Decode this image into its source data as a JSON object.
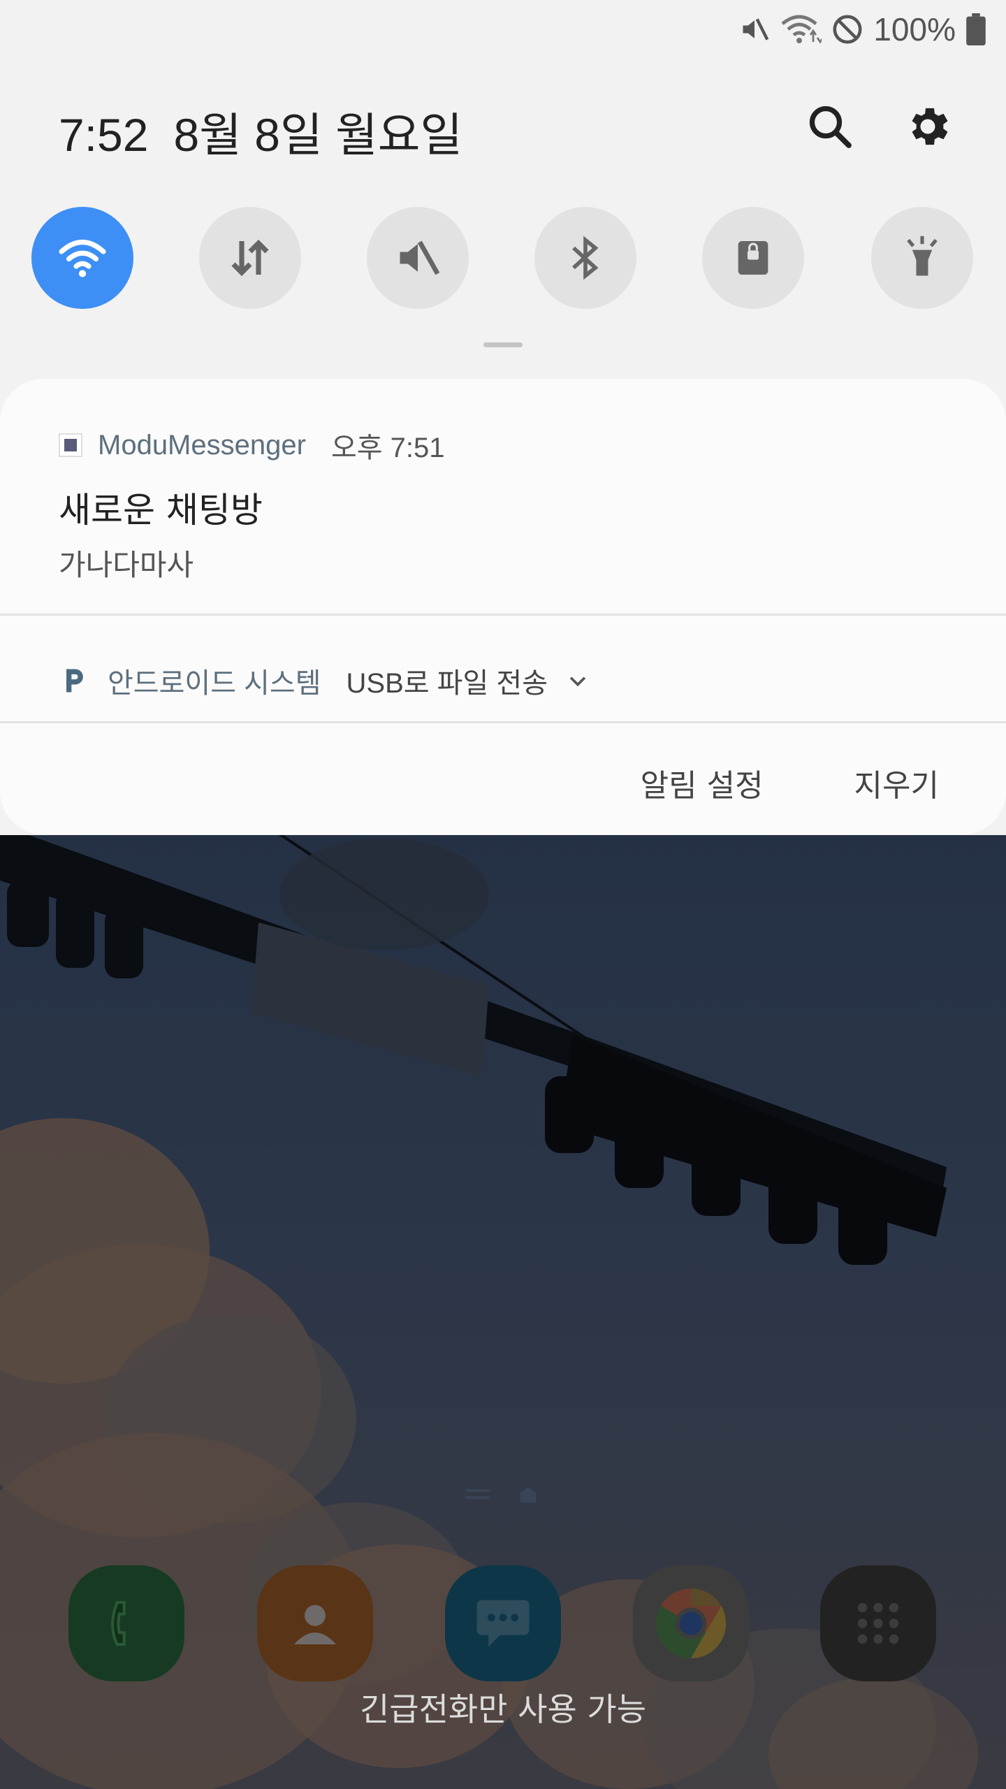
{
  "status_bar": {
    "battery": "100%",
    "icons": [
      "mute-icon",
      "wifi-data-icon",
      "do-not-disturb-icon",
      "battery-icon"
    ]
  },
  "header": {
    "time": "7:52",
    "date": "8월 8일 월요일",
    "search_icon": "search-icon",
    "settings_icon": "gear-icon"
  },
  "quick_settings": [
    {
      "name": "wifi",
      "icon": "wifi-icon",
      "active": true
    },
    {
      "name": "mobile-data",
      "icon": "data-transfer-icon",
      "active": false
    },
    {
      "name": "sound",
      "icon": "mute-icon",
      "active": false
    },
    {
      "name": "bluetooth",
      "icon": "bluetooth-icon",
      "active": false
    },
    {
      "name": "lock",
      "icon": "lock-icon",
      "active": false
    },
    {
      "name": "flashlight",
      "icon": "flashlight-icon",
      "active": false
    }
  ],
  "notification": {
    "app_name": "ModuMessenger",
    "time": "오후 7:51",
    "title": "새로운 채팅방",
    "body": "가나다마사"
  },
  "system_notification": {
    "app_name": "안드로이드 시스템",
    "text": "USB로 파일 전송"
  },
  "actions": {
    "settings_label": "알림 설정",
    "clear_label": "지우기"
  },
  "dock": {
    "apps": [
      "phone-icon",
      "contacts-icon",
      "messages-icon",
      "chrome-icon",
      "apps-icon"
    ]
  },
  "footer": {
    "emergency_text": "긴급전화만 사용 가능"
  },
  "colors": {
    "accent": "#3d8ff5",
    "shade_bg": "#f2f2f2",
    "card_bg": "#fbfbfb"
  }
}
